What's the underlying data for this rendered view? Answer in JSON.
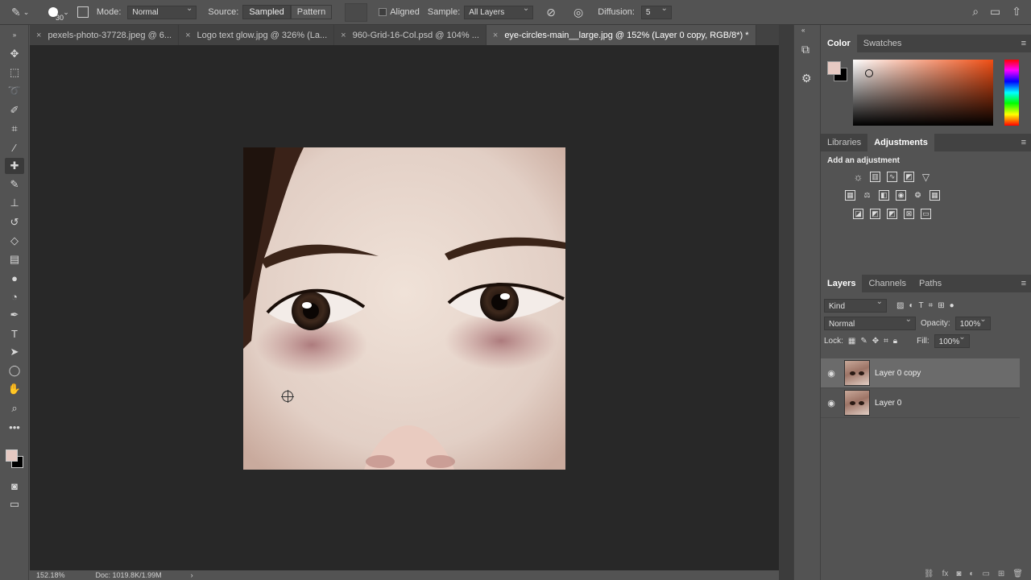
{
  "options_bar": {
    "brush_size": "30",
    "mode_label": "Mode:",
    "mode_value": "Normal",
    "source_label": "Source:",
    "source_sampled": "Sampled",
    "source_pattern": "Pattern",
    "aligned_label": "Aligned",
    "sample_label": "Sample:",
    "sample_value": "All Layers",
    "diffusion_label": "Diffusion:",
    "diffusion_value": "5"
  },
  "tabs": [
    {
      "label": "pexels-photo-37728.jpeg @ 6...",
      "active": false
    },
    {
      "label": "Logo text glow.jpg @ 326% (La...",
      "active": false
    },
    {
      "label": "960-Grid-16-Col.psd @ 104% ...",
      "active": false
    },
    {
      "label": "eye-circles-main__large.jpg @ 152% (Layer 0 copy, RGB/8*) *",
      "active": true
    }
  ],
  "status": {
    "zoom": "152.18%",
    "doc": "Doc: 1019.8K/1.99M",
    "arrow": "›"
  },
  "color_panel": {
    "tab_color": "Color",
    "tab_swatches": "Swatches",
    "foreground": "#e6c9c2",
    "background": "#000000"
  },
  "adjustments_panel": {
    "tab_libraries": "Libraries",
    "tab_adjustments": "Adjustments",
    "title": "Add an adjustment"
  },
  "layers_panel": {
    "tab_layers": "Layers",
    "tab_channels": "Channels",
    "tab_paths": "Paths",
    "kind_value": "Kind",
    "blend_mode": "Normal",
    "opacity_label": "Opacity:",
    "opacity_value": "100%",
    "lock_label": "Lock:",
    "fill_label": "Fill:",
    "fill_value": "100%",
    "layers": [
      {
        "name": "Layer 0 copy",
        "selected": true
      },
      {
        "name": "Layer 0",
        "selected": false
      }
    ]
  },
  "icons": {
    "tools": [
      "move-icon",
      "marquee-icon",
      "lasso-icon",
      "quick-select-icon",
      "crop-icon",
      "eyedropper-icon",
      "healing-brush-icon",
      "brush-icon",
      "clone-stamp-icon",
      "history-brush-icon",
      "eraser-icon",
      "gradient-icon",
      "blur-icon",
      "dodge-icon",
      "pen-icon",
      "type-icon",
      "path-select-icon",
      "ellipse-icon",
      "hand-icon",
      "zoom-icon",
      "more-icon"
    ]
  }
}
